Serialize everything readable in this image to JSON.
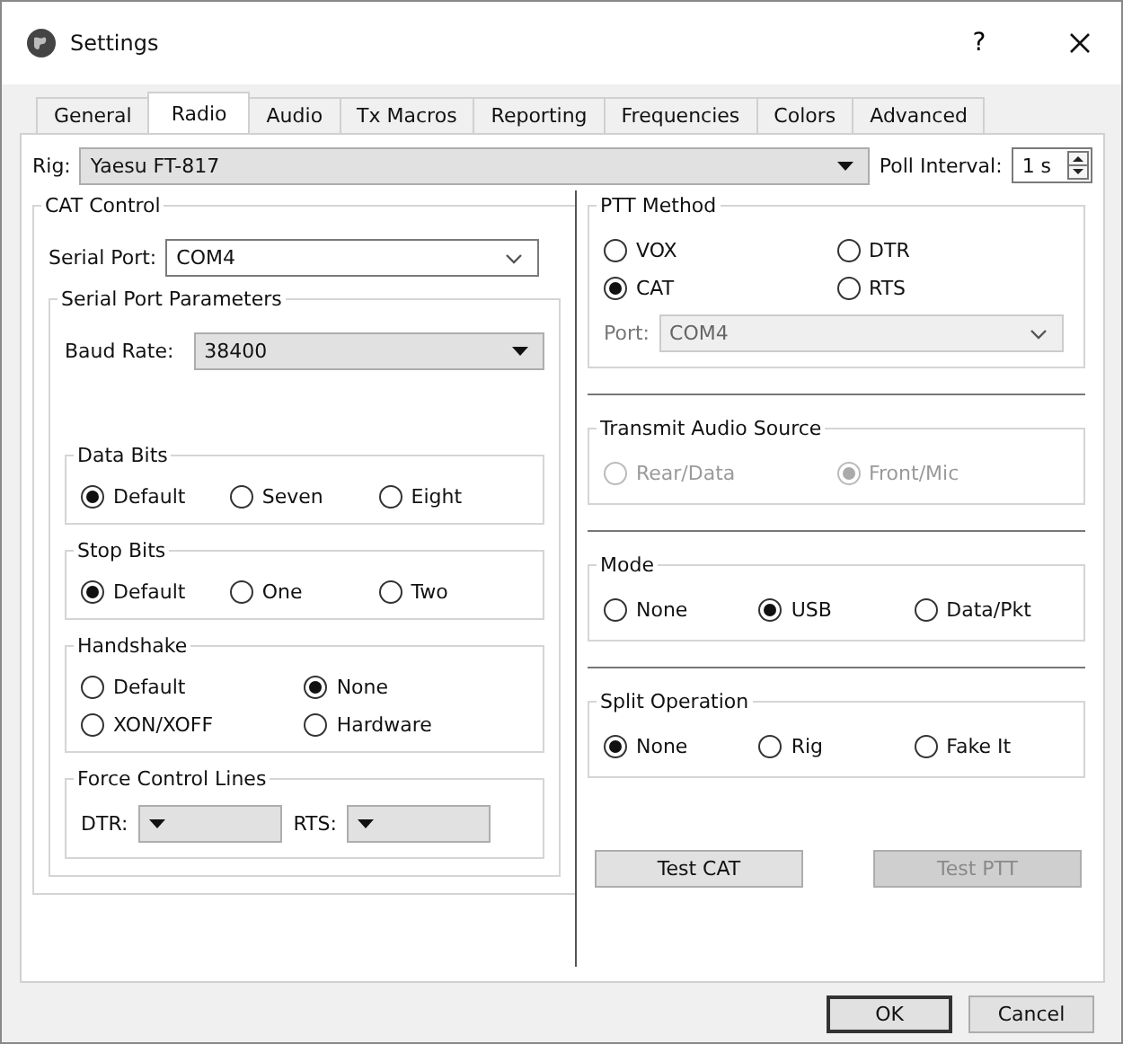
{
  "window": {
    "title": "Settings",
    "help": "?"
  },
  "tabs": [
    {
      "label": "General",
      "selected": false
    },
    {
      "label": "Radio",
      "selected": true
    },
    {
      "label": "Audio",
      "selected": false
    },
    {
      "label": "Tx Macros",
      "selected": false
    },
    {
      "label": "Reporting",
      "selected": false
    },
    {
      "label": "Frequencies",
      "selected": false
    },
    {
      "label": "Colors",
      "selected": false
    },
    {
      "label": "Advanced",
      "selected": false
    }
  ],
  "rig": {
    "label": "Rig:",
    "value": "Yaesu FT-817"
  },
  "poll_interval": {
    "label": "Poll Interval:",
    "value": "1 s"
  },
  "cat_control": {
    "title": "CAT Control",
    "serial_port": {
      "label": "Serial Port:",
      "value": "COM4"
    },
    "serial_port_parameters": {
      "title": "Serial Port Parameters",
      "baud_rate": {
        "label": "Baud Rate:",
        "value": "38400"
      },
      "groups": [
        {
          "title": "Data Bits",
          "options": [
            {
              "label": "Default",
              "selected": true
            },
            {
              "label": "Seven",
              "selected": false
            },
            {
              "label": "Eight",
              "selected": false
            }
          ]
        },
        {
          "title": "Stop Bits",
          "options": [
            {
              "label": "Default",
              "selected": true
            },
            {
              "label": "One",
              "selected": false
            },
            {
              "label": "Two",
              "selected": false
            }
          ]
        },
        {
          "title": "Handshake",
          "options": [
            {
              "label": "Default",
              "selected": false
            },
            {
              "label": "None",
              "selected": true
            },
            {
              "label": "XON/XOFF",
              "selected": false
            },
            {
              "label": "Hardware",
              "selected": false
            }
          ]
        }
      ],
      "force_control_lines": {
        "title": "Force Control Lines",
        "dtr": {
          "label": "DTR:"
        },
        "rts": {
          "label": "RTS:"
        }
      }
    }
  },
  "ptt_method": {
    "title": "PTT Method",
    "options": [
      {
        "label": "VOX",
        "selected": false
      },
      {
        "label": "DTR",
        "selected": false
      },
      {
        "label": "CAT",
        "selected": true
      },
      {
        "label": "RTS",
        "selected": false
      }
    ],
    "port": {
      "label": "Port:",
      "value": "COM4",
      "disabled": true
    }
  },
  "transmit_audio_source": {
    "title": "Transmit Audio Source",
    "disabled": true,
    "options": [
      {
        "label": "Rear/Data",
        "selected": false
      },
      {
        "label": "Front/Mic",
        "selected": true
      }
    ]
  },
  "mode": {
    "title": "Mode",
    "options": [
      {
        "label": "None",
        "selected": false
      },
      {
        "label": "USB",
        "selected": true
      },
      {
        "label": "Data/Pkt",
        "selected": false
      }
    ]
  },
  "split_operation": {
    "title": "Split Operation",
    "options": [
      {
        "label": "None",
        "selected": true
      },
      {
        "label": "Rig",
        "selected": false
      },
      {
        "label": "Fake It",
        "selected": false
      }
    ]
  },
  "test_buttons": [
    {
      "label": "Test CAT",
      "disabled": false
    },
    {
      "label": "Test PTT",
      "disabled": true
    }
  ],
  "dialog_buttons": [
    {
      "label": "OK",
      "default": true
    },
    {
      "label": "Cancel",
      "default": false
    }
  ]
}
